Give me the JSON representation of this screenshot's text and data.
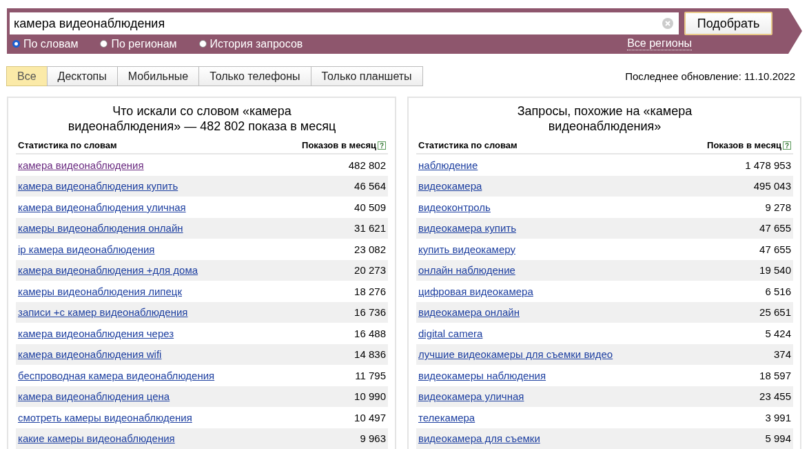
{
  "search": {
    "value": "камера видеонаблюдения",
    "button": "Подобрать"
  },
  "modes": [
    {
      "label": "По словам",
      "selected": true
    },
    {
      "label": "По регионам",
      "selected": false
    },
    {
      "label": "История запросов",
      "selected": false
    }
  ],
  "regions_link": "Все регионы",
  "tabs": [
    {
      "label": "Все",
      "selected": true
    },
    {
      "label": "Десктопы",
      "selected": false
    },
    {
      "label": "Мобильные",
      "selected": false
    },
    {
      "label": "Только телефоны",
      "selected": false
    },
    {
      "label": "Только планшеты",
      "selected": false
    }
  ],
  "last_update": "Последнее обновление: 11.10.2022",
  "panels": [
    {
      "title": "Что искали со словом «камера видеонаблюдения» — 482 802 показа в месяц",
      "columns": [
        "Статистика по словам",
        "Показов в месяц"
      ],
      "help": "?",
      "rows": [
        {
          "phrase": "камера видеонаблюдения",
          "count": "482 802",
          "visited": true
        },
        {
          "phrase": "камера видеонаблюдения купить",
          "count": "46 564",
          "visited": false
        },
        {
          "phrase": "камера видеонаблюдения уличная",
          "count": "40 509",
          "visited": false
        },
        {
          "phrase": "камеры видеонаблюдения онлайн",
          "count": "31 621",
          "visited": false
        },
        {
          "phrase": "ip камера видеонаблюдения",
          "count": "23 082",
          "visited": false
        },
        {
          "phrase": "камера видеонаблюдения +для дома",
          "count": "20 273",
          "visited": false
        },
        {
          "phrase": "камеры видеонаблюдения липецк",
          "count": "18 276",
          "visited": false
        },
        {
          "phrase": "записи +с камер видеонаблюдения",
          "count": "16 736",
          "visited": false
        },
        {
          "phrase": "камера видеонаблюдения через",
          "count": "16 488",
          "visited": false
        },
        {
          "phrase": "камера видеонаблюдения wifi",
          "count": "14 836",
          "visited": false
        },
        {
          "phrase": "беспроводная камера видеонаблюдения",
          "count": "11 795",
          "visited": false
        },
        {
          "phrase": "камера видеонаблюдения цена",
          "count": "10 990",
          "visited": false
        },
        {
          "phrase": "смотреть камеры видеонаблюдения",
          "count": "10 497",
          "visited": false
        },
        {
          "phrase": "какие камеры видеонаблюдения",
          "count": "9 963",
          "visited": false
        }
      ]
    },
    {
      "title": "Запросы, похожие на «камера видеонаблюдения»",
      "columns": [
        "Статистика по словам",
        "Показов в месяц"
      ],
      "help": "?",
      "rows": [
        {
          "phrase": "наблюдение",
          "count": "1 478 953",
          "visited": false
        },
        {
          "phrase": "видеокамера",
          "count": "495 043",
          "visited": false
        },
        {
          "phrase": "видеоконтроль",
          "count": "9 278",
          "visited": false
        },
        {
          "phrase": "видеокамера купить",
          "count": "47 655",
          "visited": false
        },
        {
          "phrase": "купить видеокамеру",
          "count": "47 655",
          "visited": false
        },
        {
          "phrase": "онлайн наблюдение",
          "count": "19 540",
          "visited": false
        },
        {
          "phrase": "цифровая видеокамера",
          "count": "6 516",
          "visited": false
        },
        {
          "phrase": "видеокамера онлайн",
          "count": "25 651",
          "visited": false
        },
        {
          "phrase": "digital camera",
          "count": "5 424",
          "visited": false
        },
        {
          "phrase": "лучшие видеокамеры для съемки видео",
          "count": "374",
          "visited": false
        },
        {
          "phrase": "видеокамеры наблюдения",
          "count": "18 597",
          "visited": false
        },
        {
          "phrase": "видеокамера уличная",
          "count": "23 455",
          "visited": false
        },
        {
          "phrase": "телекамера",
          "count": "3 991",
          "visited": false
        },
        {
          "phrase": "видеокамера для съемки",
          "count": "5 994",
          "visited": false
        }
      ]
    }
  ]
}
